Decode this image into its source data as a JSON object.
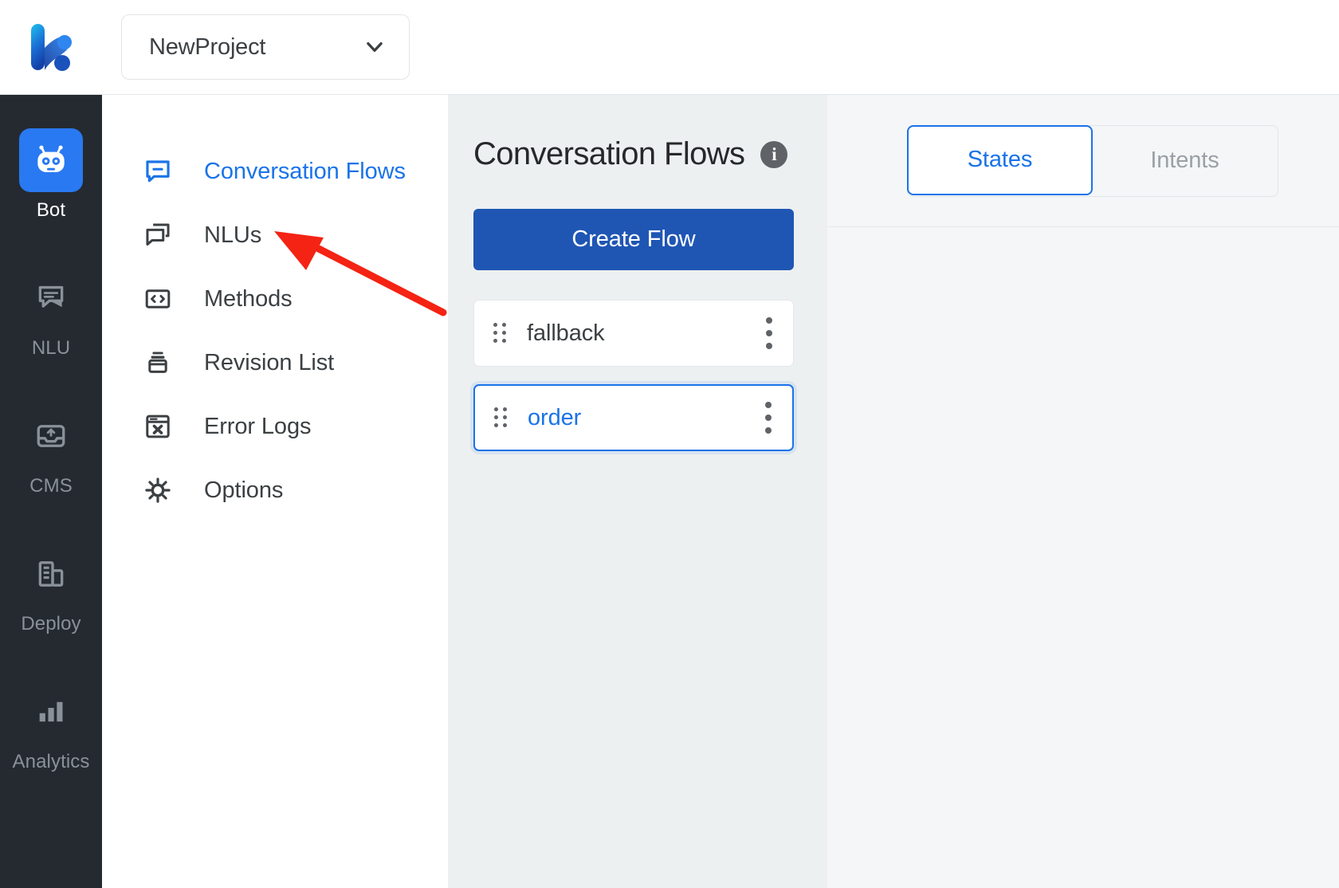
{
  "header": {
    "logo_icon": "kore-k-logo",
    "project_selector": {
      "value": "NewProject",
      "chevron_icon": "chevron-down-icon"
    }
  },
  "rail": {
    "items": [
      {
        "label": "Bot",
        "icon": "robot-icon",
        "active": true
      },
      {
        "label": "NLU",
        "icon": "speech-bubble-icon",
        "active": false
      },
      {
        "label": "CMS",
        "icon": "inbox-icon",
        "active": false
      },
      {
        "label": "Deploy",
        "icon": "building-icon",
        "active": false
      },
      {
        "label": "Analytics",
        "icon": "bar-chart-icon",
        "active": false
      }
    ]
  },
  "nav": {
    "items": [
      {
        "label": "Conversation Flows",
        "icon": "chat-box-icon",
        "active": true
      },
      {
        "label": "NLUs",
        "icon": "copy-chat-icon",
        "active": false
      },
      {
        "label": "Methods",
        "icon": "code-brackets-icon",
        "active": false
      },
      {
        "label": "Revision List",
        "icon": "archive-icon",
        "active": false
      },
      {
        "label": "Error Logs",
        "icon": "window-error-icon",
        "active": false
      },
      {
        "label": "Options",
        "icon": "gear-icon",
        "active": false
      }
    ]
  },
  "flows": {
    "title": "Conversation Flows",
    "info_icon": "info-icon",
    "info_glyph": "i",
    "create_button": "Create Flow",
    "cards": [
      {
        "name": "fallback",
        "selected": false,
        "drag_icon": "drag-handle-icon",
        "menu_icon": "kebab-menu-icon"
      },
      {
        "name": "order",
        "selected": true,
        "drag_icon": "drag-handle-icon",
        "menu_icon": "kebab-menu-icon"
      }
    ]
  },
  "right_panel": {
    "tabs": [
      {
        "label": "States",
        "active": true
      },
      {
        "label": "Intents",
        "active": false
      }
    ]
  },
  "annotation": {
    "arrow_icon": "red-pointer-arrow",
    "color": "#f42314",
    "points_to": "NLUs"
  },
  "colors": {
    "accent_blue": "#1a73e8",
    "primary_button": "#1f56b4",
    "rail_bg": "#252a31",
    "center_bg": "#edf0f1",
    "right_bg": "#f4f6f7"
  }
}
